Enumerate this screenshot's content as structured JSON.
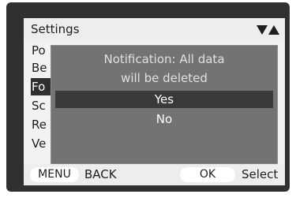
{
  "header": {
    "title": "Settings",
    "scroll_icons": [
      "triangle-down",
      "triangle-up"
    ]
  },
  "menu": {
    "items": [
      {
        "label": "Po"
      },
      {
        "label": "Be"
      },
      {
        "label": "Fo",
        "selected": true
      },
      {
        "label": "Sc"
      },
      {
        "label": "Re"
      },
      {
        "label": "Ve"
      }
    ]
  },
  "dialog": {
    "message_line1": "Notification:  All data",
    "message_line2": "will be deleted",
    "options": [
      {
        "label": "Yes",
        "highlighted": true
      },
      {
        "label": "No",
        "highlighted": false
      }
    ]
  },
  "footer": {
    "menu_key": "MENU",
    "menu_action": "BACK",
    "ok_key": "OK",
    "ok_action": "Select"
  }
}
